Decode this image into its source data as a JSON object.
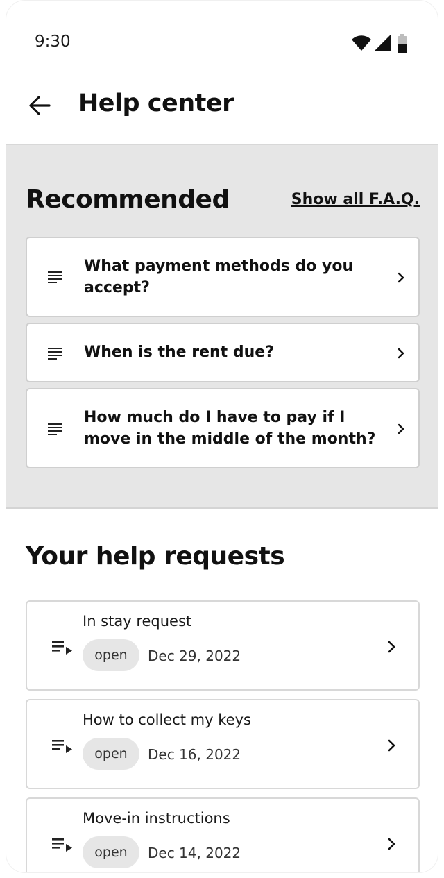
{
  "status_bar": {
    "time": "9:30"
  },
  "app_bar": {
    "title": "Help center"
  },
  "recommended": {
    "title": "Recommended",
    "show_all_label": "Show all F.A.Q.",
    "items": [
      {
        "label": "What payment methods do you accept?"
      },
      {
        "label": "When is the rent due?"
      },
      {
        "label": "How much do I have to pay if I move in the middle of the month?"
      }
    ]
  },
  "help_requests": {
    "title": "Your help requests",
    "items": [
      {
        "title": "In stay request",
        "status": "open",
        "date": "Dec 29, 2022"
      },
      {
        "title": "How to collect my keys",
        "status": "open",
        "date": "Dec 16, 2022"
      },
      {
        "title": "Move-in instructions",
        "status": "open",
        "date": "Dec 14, 2022"
      }
    ]
  },
  "icons": {
    "back": "arrow-left-icon",
    "faq": "article-lines-icon",
    "request": "playlist-play-icon",
    "chevron": "chevron-right-icon",
    "wifi": "wifi-icon",
    "signal": "cell-signal-icon",
    "battery": "battery-icon"
  }
}
